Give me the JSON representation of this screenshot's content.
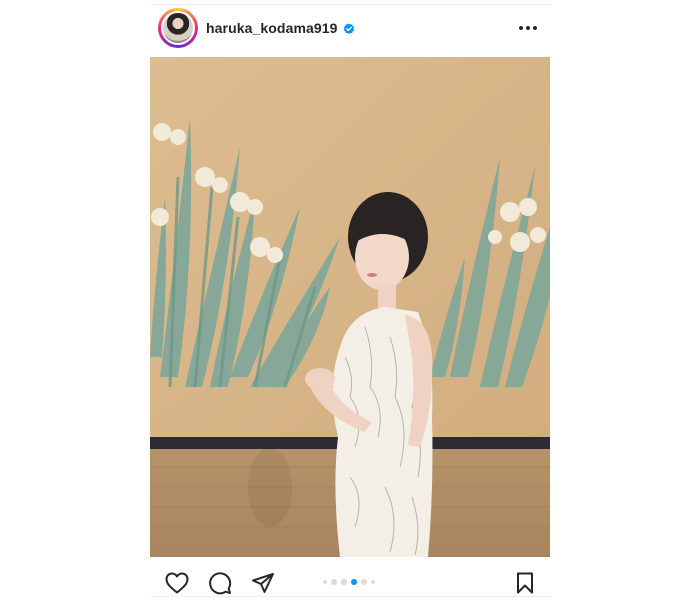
{
  "post": {
    "username": "haruka_kodama919",
    "verified": true,
    "carousel": {
      "total_visible_dots": 6,
      "active_index": 3
    }
  },
  "colors": {
    "accent": "#0095f6",
    "text": "#262626",
    "divider": "#efefef"
  },
  "icons": {
    "header": [
      "verified-badge-icon",
      "more-options-icon"
    ],
    "actions": [
      "heart-icon",
      "comment-icon",
      "share-icon",
      "bookmark-icon"
    ]
  }
}
